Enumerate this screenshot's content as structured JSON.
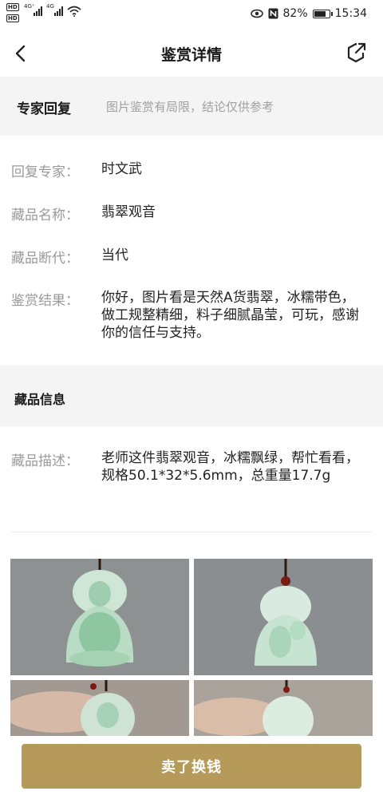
{
  "status_bar": {
    "hd1": "HD",
    "hd2": "HD",
    "net1": "4G⁺",
    "net2": "4G",
    "battery_percent": "82%",
    "battery_level": 0.82,
    "time": "15:34"
  },
  "nav": {
    "title": "鉴赏详情"
  },
  "expert_section": {
    "title": "专家回复",
    "note": "图片鉴赏有局限，结论仅供参考"
  },
  "expert_rows": [
    {
      "label": "回复专家：",
      "value": "时文武"
    },
    {
      "label": "藏品名称：",
      "value": "翡翠观音"
    },
    {
      "label": "藏品断代：",
      "value": "当代"
    },
    {
      "label": "鉴赏结果：",
      "value": "你好，图片看是天然A货翡翠，冰糯带色，做工规整精细，料子细腻晶莹，可玩，感谢你的信任与支持。"
    }
  ],
  "item_section": {
    "title": "藏品信息"
  },
  "item_rows": [
    {
      "label": "藏品描述：",
      "value": "老师这件翡翠观音，冰糯飘绿，帮忙看看，规格50.1*32*5.6mm，总重量17.7g"
    }
  ],
  "colors": {
    "accent": "#b59a5a",
    "section_bg": "#f4f4f4",
    "label_gray": "#9a9a9a"
  },
  "bottom": {
    "sell_label": "卖了换钱"
  }
}
